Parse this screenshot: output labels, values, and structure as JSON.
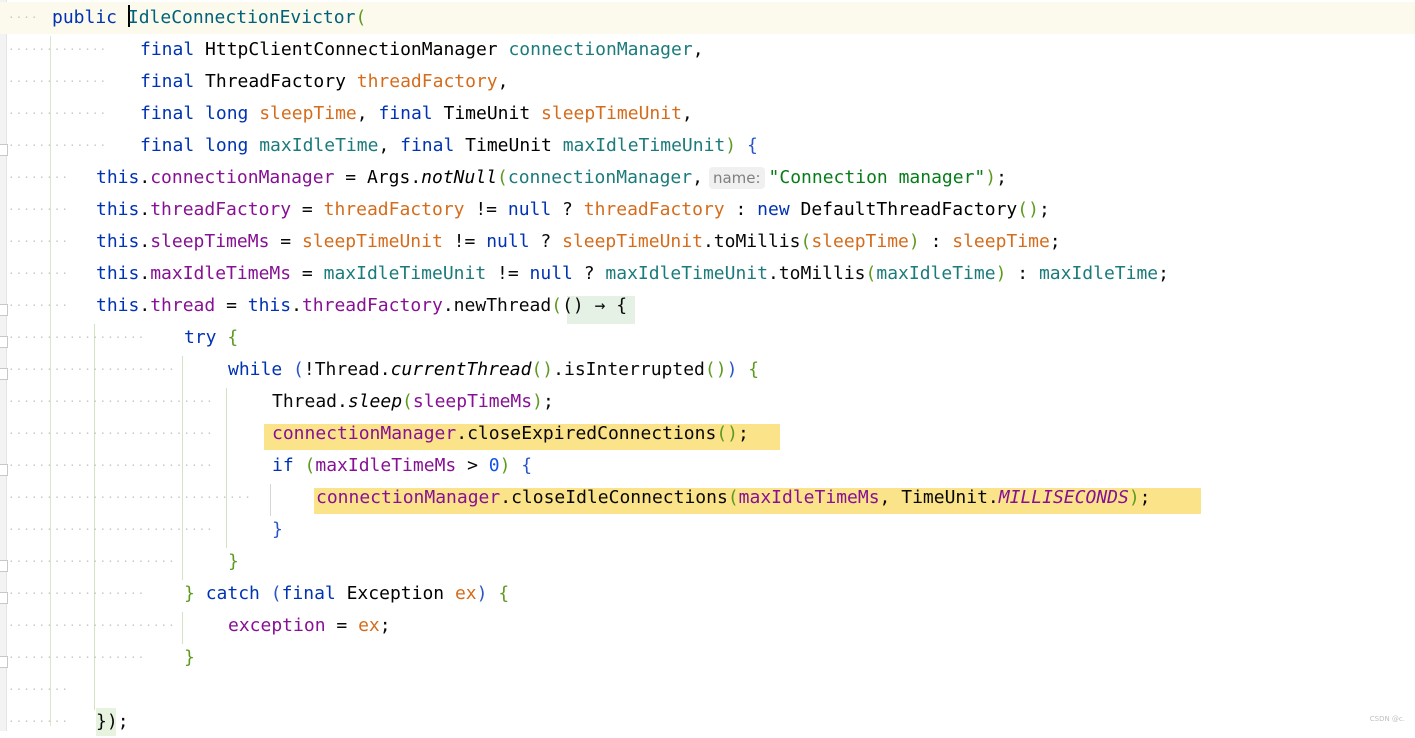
{
  "editor": {
    "lines": [
      {
        "cls": "current",
        "indent": 52,
        "tokens": [
          {
            "t": "public ",
            "c": "kw"
          },
          {
            "caret": true
          },
          {
            "t": "IdleConnectionEvictor",
            "c": "ctor"
          },
          {
            "t": "(",
            "c": "brc"
          }
        ]
      },
      {
        "indent": 140,
        "tokens": [
          {
            "t": "final ",
            "c": "kw"
          },
          {
            "t": "HttpClientConnectionManager ",
            "c": "tp"
          },
          {
            "t": "connectionManager",
            "c": "prm"
          },
          {
            "t": ",",
            "c": "plain"
          }
        ]
      },
      {
        "indent": 140,
        "tokens": [
          {
            "t": "final ",
            "c": "kw"
          },
          {
            "t": "ThreadFactory ",
            "c": "tp"
          },
          {
            "t": "threadFactory",
            "c": "prm2"
          },
          {
            "t": ",",
            "c": "plain"
          }
        ]
      },
      {
        "indent": 140,
        "tokens": [
          {
            "t": "final ",
            "c": "kw"
          },
          {
            "t": "long ",
            "c": "kw"
          },
          {
            "t": "sleepTime",
            "c": "prm2"
          },
          {
            "t": ", ",
            "c": "plain"
          },
          {
            "t": "final ",
            "c": "kw"
          },
          {
            "t": "TimeUnit ",
            "c": "tp"
          },
          {
            "t": "sleepTimeUnit",
            "c": "prm2"
          },
          {
            "t": ",",
            "c": "plain"
          }
        ]
      },
      {
        "indent": 140,
        "tokens": [
          {
            "t": "final ",
            "c": "kw"
          },
          {
            "t": "long ",
            "c": "kw"
          },
          {
            "t": "maxIdleTime",
            "c": "prm"
          },
          {
            "t": ", ",
            "c": "plain"
          },
          {
            "t": "final ",
            "c": "kw"
          },
          {
            "t": "TimeUnit ",
            "c": "tp"
          },
          {
            "t": "maxIdleTimeUnit",
            "c": "prm"
          },
          {
            "t": ") ",
            "c": "brc"
          },
          {
            "t": "{",
            "c": "brb"
          }
        ]
      },
      {
        "indent": 96,
        "tokens": [
          {
            "t": "this",
            "c": "kw"
          },
          {
            "t": ".",
            "c": "plain"
          },
          {
            "t": "connectionManager",
            "c": "fld"
          },
          {
            "t": " = ",
            "c": "plain"
          },
          {
            "t": "Args",
            "c": "tp"
          },
          {
            "t": ".",
            "c": "plain"
          },
          {
            "t": "notNull",
            "c": "tp it"
          },
          {
            "t": "(",
            "c": "brc"
          },
          {
            "t": "connectionManager",
            "c": "prm"
          },
          {
            "t": ",",
            "c": "plain"
          },
          {
            "hint": "name:"
          },
          {
            "t": "\"Connection manager\"",
            "c": "str"
          },
          {
            "t": ")",
            "c": "brc"
          },
          {
            "t": ";",
            "c": "plain"
          }
        ]
      },
      {
        "indent": 96,
        "tokens": [
          {
            "t": "this",
            "c": "kw"
          },
          {
            "t": ".",
            "c": "plain"
          },
          {
            "t": "threadFactory",
            "c": "fld"
          },
          {
            "t": " = ",
            "c": "plain"
          },
          {
            "t": "threadFactory",
            "c": "prm2"
          },
          {
            "t": " != ",
            "c": "plain"
          },
          {
            "t": "null",
            "c": "kw"
          },
          {
            "t": " ? ",
            "c": "plain"
          },
          {
            "t": "threadFactory",
            "c": "prm2"
          },
          {
            "t": " : ",
            "c": "plain"
          },
          {
            "t": "new ",
            "c": "kw"
          },
          {
            "t": "DefaultThreadFactory",
            "c": "tp"
          },
          {
            "t": "()",
            "c": "brc"
          },
          {
            "t": ";",
            "c": "plain"
          }
        ]
      },
      {
        "indent": 96,
        "tokens": [
          {
            "t": "this",
            "c": "kw"
          },
          {
            "t": ".",
            "c": "plain"
          },
          {
            "t": "sleepTimeMs",
            "c": "fld"
          },
          {
            "t": " = ",
            "c": "plain"
          },
          {
            "t": "sleepTimeUnit",
            "c": "prm2"
          },
          {
            "t": " != ",
            "c": "plain"
          },
          {
            "t": "null",
            "c": "kw"
          },
          {
            "t": " ? ",
            "c": "plain"
          },
          {
            "t": "sleepTimeUnit",
            "c": "prm2"
          },
          {
            "t": ".toMillis",
            "c": "plain"
          },
          {
            "t": "(",
            "c": "brc"
          },
          {
            "t": "sleepTime",
            "c": "prm2"
          },
          {
            "t": ")",
            "c": "brc"
          },
          {
            "t": " : ",
            "c": "plain"
          },
          {
            "t": "sleepTime",
            "c": "prm2"
          },
          {
            "t": ";",
            "c": "plain"
          }
        ]
      },
      {
        "indent": 96,
        "tokens": [
          {
            "t": "this",
            "c": "kw"
          },
          {
            "t": ".",
            "c": "plain"
          },
          {
            "t": "maxIdleTimeMs",
            "c": "fld"
          },
          {
            "t": " = ",
            "c": "plain"
          },
          {
            "t": "maxIdleTimeUnit",
            "c": "prm"
          },
          {
            "t": " != ",
            "c": "plain"
          },
          {
            "t": "null",
            "c": "kw"
          },
          {
            "t": " ? ",
            "c": "plain"
          },
          {
            "t": "maxIdleTimeUnit",
            "c": "prm"
          },
          {
            "t": ".toMillis",
            "c": "plain"
          },
          {
            "t": "(",
            "c": "brc"
          },
          {
            "t": "maxIdleTime",
            "c": "prm"
          },
          {
            "t": ")",
            "c": "brc"
          },
          {
            "t": " : ",
            "c": "plain"
          },
          {
            "t": "maxIdleTime",
            "c": "prm"
          },
          {
            "t": ";",
            "c": "plain"
          }
        ]
      },
      {
        "indent": 96,
        "tokens": [
          {
            "t": "this",
            "c": "kw"
          },
          {
            "t": ".",
            "c": "plain"
          },
          {
            "t": "thread",
            "c": "fld"
          },
          {
            "t": " = ",
            "c": "plain"
          },
          {
            "t": "this",
            "c": "kw"
          },
          {
            "t": ".",
            "c": "plain"
          },
          {
            "t": "threadFactory",
            "c": "fld"
          },
          {
            "t": ".newThread",
            "c": "plain"
          },
          {
            "t": "(",
            "c": "brc"
          },
          {
            "t": "() → {",
            "c": "plain"
          }
        ]
      },
      {
        "indent": 184,
        "tokens": [
          {
            "t": "try ",
            "c": "kw"
          },
          {
            "t": "{",
            "c": "brc"
          }
        ]
      },
      {
        "indent": 228,
        "tokens": [
          {
            "t": "while ",
            "c": "kw"
          },
          {
            "t": "(",
            "c": "brb"
          },
          {
            "t": "!Thread.",
            "c": "plain"
          },
          {
            "t": "currentThread",
            "c": "tp it"
          },
          {
            "t": "()",
            "c": "brc"
          },
          {
            "t": ".isInterrupted",
            "c": "plain"
          },
          {
            "t": "()",
            "c": "brc"
          },
          {
            "t": ") ",
            "c": "brb"
          },
          {
            "t": "{",
            "c": "brc"
          }
        ]
      },
      {
        "indent": 272,
        "tokens": [
          {
            "t": "Thread.",
            "c": "plain"
          },
          {
            "t": "sleep",
            "c": "tp it"
          },
          {
            "t": "(",
            "c": "brc"
          },
          {
            "t": "sleepTimeMs",
            "c": "fld"
          },
          {
            "t": ")",
            "c": "brc"
          },
          {
            "t": ";",
            "c": "plain"
          }
        ]
      },
      {
        "indent": 272,
        "tokens": [
          {
            "t": "connectionManager",
            "c": "fld"
          },
          {
            "t": ".closeExpiredConnections",
            "c": "plain"
          },
          {
            "t": "()",
            "c": "brc"
          },
          {
            "t": ";",
            "c": "plain"
          }
        ]
      },
      {
        "indent": 272,
        "tokens": [
          {
            "t": "if ",
            "c": "kw"
          },
          {
            "t": "(",
            "c": "brc"
          },
          {
            "t": "maxIdleTimeMs",
            "c": "fld"
          },
          {
            "t": " > ",
            "c": "plain"
          },
          {
            "t": "0",
            "c": "num"
          },
          {
            "t": ") ",
            "c": "brc"
          },
          {
            "t": "{",
            "c": "brb"
          }
        ]
      },
      {
        "indent": 316,
        "tokens": [
          {
            "t": "connectionManager",
            "c": "fld"
          },
          {
            "t": ".closeIdleConnections",
            "c": "plain"
          },
          {
            "t": "(",
            "c": "brc"
          },
          {
            "t": "maxIdleTimeMs",
            "c": "fld"
          },
          {
            "t": ", ",
            "c": "plain"
          },
          {
            "t": "TimeUnit.",
            "c": "plain"
          },
          {
            "t": "MILLISECONDS",
            "c": "cst"
          },
          {
            "t": ")",
            "c": "brc"
          },
          {
            "t": ";",
            "c": "plain"
          }
        ]
      },
      {
        "indent": 272,
        "tokens": [
          {
            "t": "}",
            "c": "brb"
          }
        ]
      },
      {
        "indent": 228,
        "tokens": [
          {
            "t": "}",
            "c": "brc"
          }
        ]
      },
      {
        "indent": 184,
        "tokens": [
          {
            "t": "} ",
            "c": "brc"
          },
          {
            "t": "catch ",
            "c": "kw"
          },
          {
            "t": "(",
            "c": "brb"
          },
          {
            "t": "final ",
            "c": "kw"
          },
          {
            "t": "Exception ",
            "c": "tp"
          },
          {
            "t": "ex",
            "c": "prm2"
          },
          {
            "t": ") ",
            "c": "brb"
          },
          {
            "t": "{",
            "c": "brc"
          }
        ]
      },
      {
        "indent": 228,
        "tokens": [
          {
            "t": "exception",
            "c": "fld"
          },
          {
            "t": " = ",
            "c": "plain"
          },
          {
            "t": "ex",
            "c": "prm2"
          },
          {
            "t": ";",
            "c": "plain"
          }
        ]
      },
      {
        "indent": 184,
        "tokens": [
          {
            "t": "}",
            "c": "brc"
          }
        ]
      },
      {
        "indent": 96,
        "tokens": []
      },
      {
        "indent": 96,
        "tokens": [
          {
            "t": "})",
            "c": "plain"
          },
          {
            "t": ";",
            "c": "plain"
          }
        ]
      }
    ],
    "dot_leaders": true
  },
  "watermark": "CSDN @c."
}
